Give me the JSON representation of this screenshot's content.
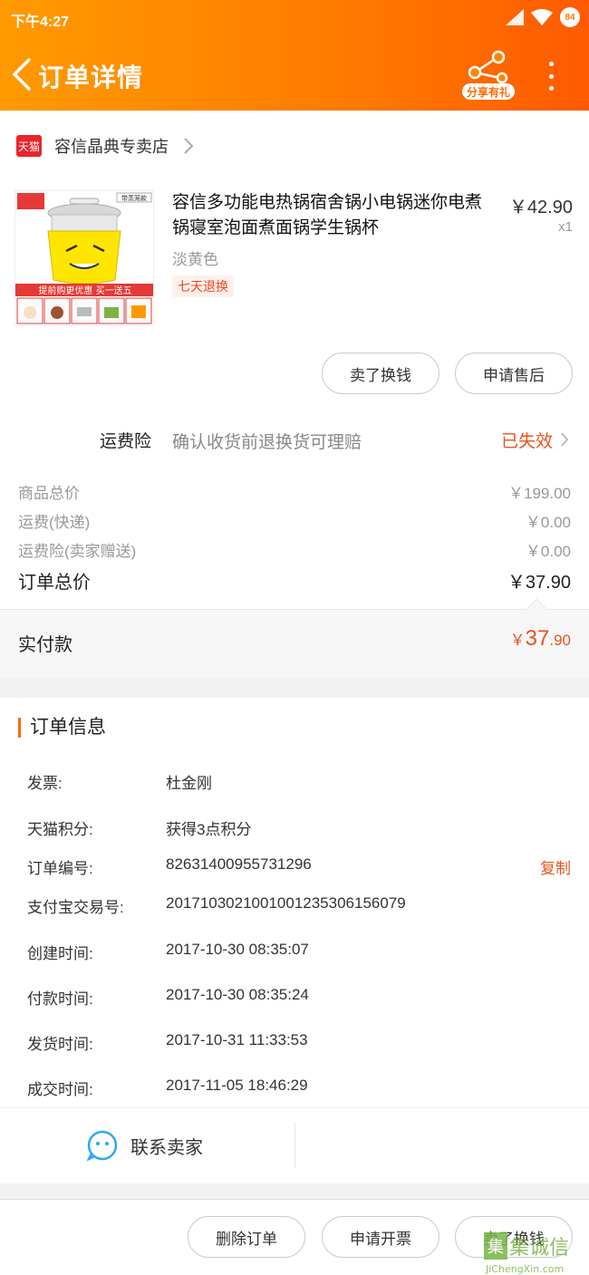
{
  "status_bar": {
    "time": "下午4:27",
    "battery": "84"
  },
  "nav": {
    "title": "订单详情",
    "share_badge": "分享有礼"
  },
  "shop": {
    "badge": "天猫",
    "name": "容信晶典专卖店"
  },
  "product": {
    "title": "容信多功能电热锅宿舍锅小电锅迷你电煮锅寝室泡面煮面锅学生锅杯",
    "variant": "淡黄色",
    "tag": "七天退换",
    "price": "￥42.90",
    "qty": "x1",
    "image_banner": "提前购更优惠 买一送五",
    "image_badge": "带蒸笼款"
  },
  "item_buttons": {
    "sell": "卖了换钱",
    "after_sale": "申请售后"
  },
  "insurance": {
    "label": "运费险",
    "desc": "确认收货前退换货可理赔",
    "status": "已失效"
  },
  "summary": [
    {
      "label": "商品总价",
      "value": "￥199.00"
    },
    {
      "label": "运费(快递)",
      "value": "￥0.00"
    },
    {
      "label": "运费险(卖家赠送)",
      "value": "￥0.00"
    }
  ],
  "order_total": {
    "label": "订单总价",
    "value": "￥37.90"
  },
  "paid": {
    "label": "实付款",
    "currency": "￥",
    "main": "37",
    "decimal": ".90"
  },
  "order_info": {
    "title": "订单信息",
    "invoice": {
      "label": "发票:",
      "value": "杜金刚"
    },
    "points": {
      "label": "天猫积分:",
      "value": "获得3点积分"
    },
    "order_no": {
      "label": "订单编号:",
      "value": "82631400955731296",
      "copy": "复制"
    },
    "alipay_no": {
      "label": "支付宝交易号:",
      "value": "2017103021001001235306156079"
    },
    "created": {
      "label": "创建时间:",
      "value": "2017-10-30 08:35:07"
    },
    "paid_time": {
      "label": "付款时间:",
      "value": "2017-10-30 08:35:24"
    },
    "shipped": {
      "label": "发货时间:",
      "value": "2017-10-31 11:33:53"
    },
    "completed": {
      "label": "成交时间:",
      "value": "2017-11-05 18:46:29"
    }
  },
  "contact": {
    "label": "联系卖家"
  },
  "bottom_buttons": {
    "delete": "删除订单",
    "invoice": "申请开票",
    "sell": "卖了换钱"
  },
  "watermark": {
    "cn": "集诚信",
    "en": "JiChengXin.com"
  },
  "colors": {
    "brand": "#ff7a00",
    "accent": "#e8541e"
  }
}
